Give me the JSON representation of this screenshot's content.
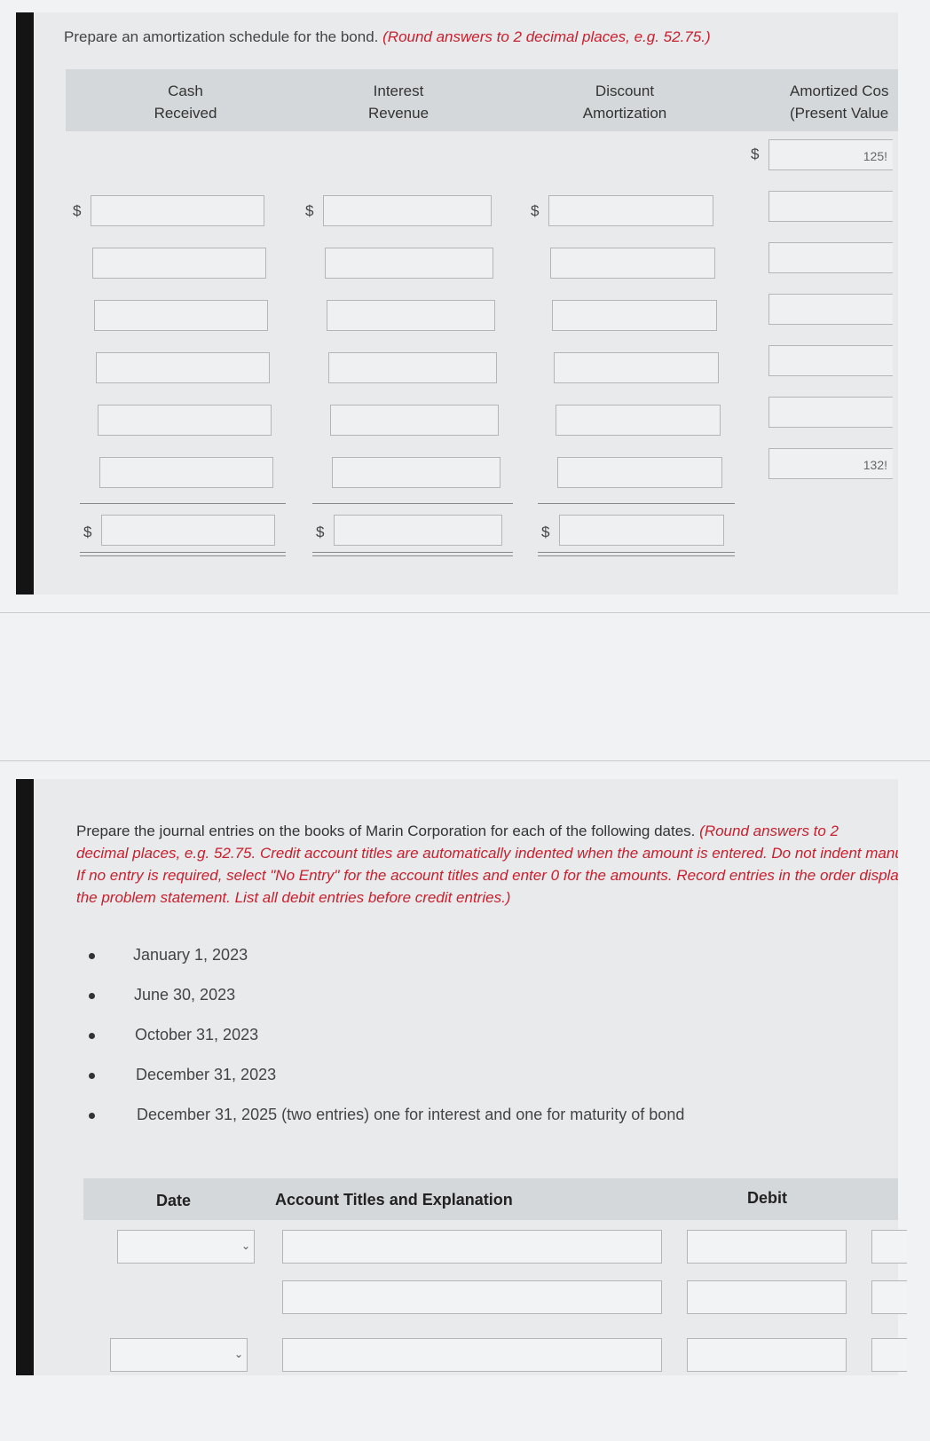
{
  "schedule": {
    "instruction": "Prepare an amortization schedule for the bond.",
    "instruction_note": "(Round answers to 2 decimal places, e.g. 52.75.)",
    "columns": [
      {
        "line1": "Cash",
        "line2": "Received"
      },
      {
        "line1": "Interest",
        "line2": "Revenue"
      },
      {
        "line1": "Discount",
        "line2": "Amortization"
      },
      {
        "line1": "Amortized Cos",
        "line2": "(Present Value"
      }
    ],
    "currency_symbol": "$",
    "amortized_cost_first": "125!",
    "amortized_cost_last": "132!"
  },
  "journal": {
    "instruction": "Prepare the journal entries on the books of Marin Corporation for each of the following dates.",
    "instruction_note_lines": [
      "(Round answers to 2",
      "decimal places, e.g. 52.75. Credit account titles are automatically indented when the amount is entered. Do not indent manual",
      "If no entry is required, select \"No Entry\" for the account titles and enter 0 for the amounts. Record entries in the order displayed",
      "the problem statement. List all debit entries before credit entries.)"
    ],
    "dates": [
      "January 1, 2023",
      "June 30, 2023",
      "October 31, 2023",
      "December 31, 2023",
      "December 31, 2025 (two entries) one for interest and one for maturity of bond"
    ],
    "table_headers": {
      "date": "Date",
      "account": "Account Titles and Explanation",
      "debit": "Debit"
    }
  },
  "colors": {
    "accent_red": "#c8202f",
    "header_gray": "#d5d8da"
  }
}
